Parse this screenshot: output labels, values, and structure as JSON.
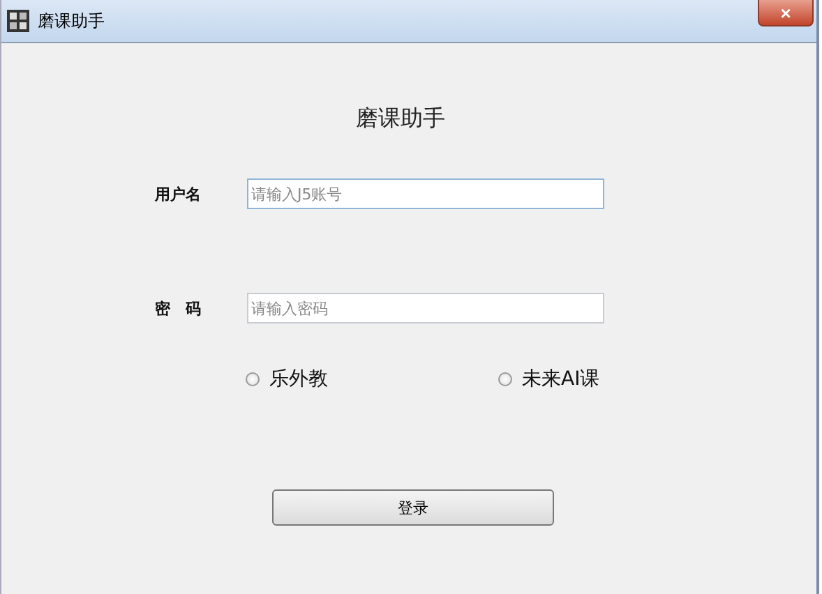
{
  "window": {
    "title": "磨课助手",
    "close": "×"
  },
  "heading": "磨课助手",
  "fields": [
    {
      "label": "用户名",
      "placeholder": "请输入J5账号",
      "focused": true
    },
    {
      "label": "密　码",
      "placeholder": "请输入密码",
      "focused": false
    }
  ],
  "options": [
    {
      "label": "乐外教",
      "selected": false
    },
    {
      "label": "未来AI课",
      "selected": false
    }
  ],
  "button": "登录"
}
